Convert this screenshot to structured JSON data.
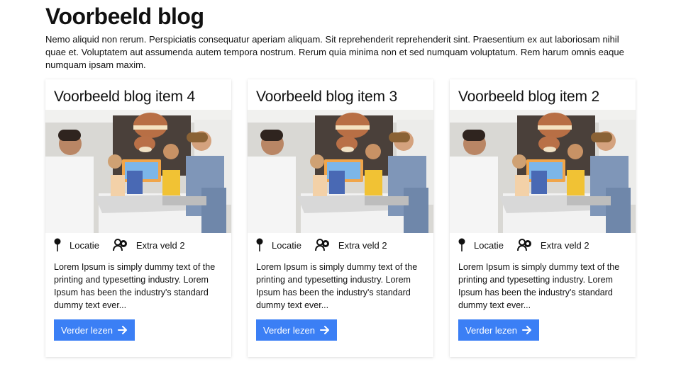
{
  "page": {
    "title": "Voorbeeld blog",
    "intro": "Nemo aliquid non rerum. Perspiciatis consequatur aperiam aliquam. Sit reprehenderit reprehenderit sint. Praesentium ex aut laboriosam nihil quae et. Voluptatem aut assumenda autem tempora nostrum. Rerum quia minima non et sed numquam voluptatum. Rem harum omnis eaque numquam ipsam maxim."
  },
  "posts": [
    {
      "title": "Voorbeeld blog item 4",
      "location_label": "Locatie",
      "extra_label": "Extra veld 2",
      "excerpt": "Lorem Ipsum is simply dummy text of the printing and typesetting industry. Lorem Ipsum has been the industry's standard dummy text ever...",
      "cta": "Verder lezen"
    },
    {
      "title": "Voorbeeld blog item 3",
      "location_label": "Locatie",
      "extra_label": "Extra veld 2",
      "excerpt": "Lorem Ipsum is simply dummy text of the printing and typesetting industry. Lorem Ipsum has been the industry's standard dummy text ever...",
      "cta": "Verder lezen"
    },
    {
      "title": "Voorbeeld blog item 2",
      "location_label": "Locatie",
      "extra_label": "Extra veld 2",
      "excerpt": "Lorem Ipsum is simply dummy text of the printing and typesetting industry. Lorem Ipsum has been the industry's standard dummy text ever...",
      "cta": "Verder lezen"
    }
  ],
  "icons": {
    "location": "map-pin-icon",
    "extra": "user-badge-icon",
    "arrow": "arrow-right-icon"
  },
  "colors": {
    "button": "#3b7ff5",
    "button_text": "#ffffff",
    "text": "#111111"
  }
}
